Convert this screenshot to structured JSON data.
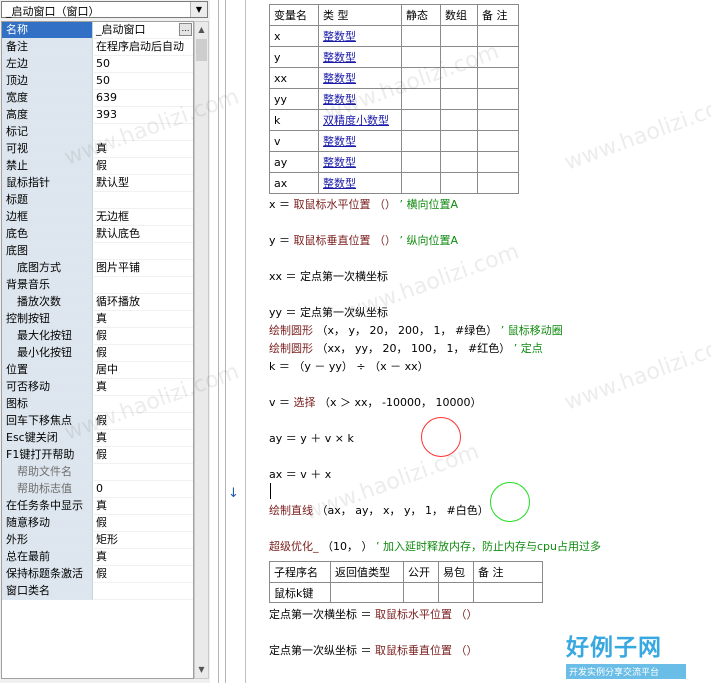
{
  "window_selector": {
    "value": "_启动窗口（窗口）"
  },
  "properties": [
    {
      "name": "名称",
      "value": "_启动窗口",
      "indent": false,
      "selected": true,
      "ellipsis": true
    },
    {
      "name": "备注",
      "value": "在程序启动后自动",
      "indent": false
    },
    {
      "name": "左边",
      "value": "50",
      "indent": false
    },
    {
      "name": "顶边",
      "value": "50",
      "indent": false
    },
    {
      "name": "宽度",
      "value": "639",
      "indent": false
    },
    {
      "name": "高度",
      "value": "393",
      "indent": false
    },
    {
      "name": "标记",
      "value": "",
      "indent": false
    },
    {
      "name": "可视",
      "value": "真",
      "indent": false
    },
    {
      "name": "禁止",
      "value": "假",
      "indent": false
    },
    {
      "name": "鼠标指针",
      "value": "默认型",
      "indent": false
    },
    {
      "name": "标题",
      "value": "",
      "indent": false
    },
    {
      "name": "边框",
      "value": "无边框",
      "indent": false
    },
    {
      "name": "底色",
      "value": "默认底色",
      "indent": false
    },
    {
      "name": "底图",
      "value": "",
      "indent": false
    },
    {
      "name": "底图方式",
      "value": "图片平铺",
      "indent": true
    },
    {
      "name": "背景音乐",
      "value": "",
      "indent": false
    },
    {
      "name": "播放次数",
      "value": "循环播放",
      "indent": true
    },
    {
      "name": "控制按钮",
      "value": "真",
      "indent": false
    },
    {
      "name": "最大化按钮",
      "value": "假",
      "indent": true
    },
    {
      "name": "最小化按钮",
      "value": "假",
      "indent": true
    },
    {
      "name": "位置",
      "value": "居中",
      "indent": false
    },
    {
      "name": "可否移动",
      "value": "真",
      "indent": false
    },
    {
      "name": "图标",
      "value": "",
      "indent": false
    },
    {
      "name": "回车下移焦点",
      "value": "假",
      "indent": false
    },
    {
      "name": "Esc键关闭",
      "value": "真",
      "indent": false
    },
    {
      "name": "F1键打开帮助",
      "value": "假",
      "indent": false
    },
    {
      "name": "帮助文件名",
      "value": "",
      "indent": true,
      "dim": true
    },
    {
      "name": "帮助标志值",
      "value": "0",
      "indent": true,
      "dim": true
    },
    {
      "name": "在任务条中显示",
      "value": "真",
      "indent": false
    },
    {
      "name": "随意移动",
      "value": "假",
      "indent": false
    },
    {
      "name": "外形",
      "value": "矩形",
      "indent": false
    },
    {
      "name": "总在最前",
      "value": "真",
      "indent": false
    },
    {
      "name": "保持标题条激活",
      "value": "假",
      "indent": false
    },
    {
      "name": "窗口类名",
      "value": "",
      "indent": false
    }
  ],
  "var_table": {
    "headers": [
      "变量名",
      "类 型",
      "静态",
      "数组",
      "备 注"
    ],
    "rows": [
      {
        "name": "x",
        "type": "整数型"
      },
      {
        "name": "y",
        "type": "整数型"
      },
      {
        "name": "xx",
        "type": "整数型"
      },
      {
        "name": "yy",
        "type": "整数型"
      },
      {
        "name": "k",
        "type": "双精度小数型"
      },
      {
        "name": "v",
        "type": "整数型"
      },
      {
        "name": "ay",
        "type": "整数型"
      },
      {
        "name": "ax",
        "type": "整数型"
      }
    ]
  },
  "code": {
    "l1": {
      "lhs": "x ＝ ",
      "fn": "取鼠标水平位置 （）",
      "cmt": " ’ 横向位置A"
    },
    "l2": {
      "lhs": "y ＝ ",
      "fn": "取鼠标垂直位置 （）",
      "cmt": " ’ 纵向位置A"
    },
    "l3": {
      "text": "xx ＝ 定点第一次横坐标"
    },
    "l4": {
      "text": "yy ＝ 定点第一次纵坐标"
    },
    "l5": {
      "fn": "绘制圆形",
      "args": " （x， y， 20， 200， 1， #绿色） ",
      "cmt": "’ 鼠标移动圈"
    },
    "l6": {
      "fn": "绘制圆形",
      "args": " （xx， yy， 20， 100， 1， #红色） ",
      "cmt": "’ 定点"
    },
    "l7": {
      "text": "k ＝ （y － yy） ÷ （x － xx）"
    },
    "l8": {
      "lhs": "v ＝ ",
      "fn": "选择",
      "args": " （x ＞ xx， -10000， 10000）"
    },
    "l9": {
      "text": "ay ＝ y ＋ v × k"
    },
    "l10": {
      "text": "ax ＝ v ＋ x"
    },
    "l11": {
      "fn": "绘制直线",
      "args": " （ax， ay， x， y， 1， #白色）"
    },
    "l12": {
      "fn": "超级优化_",
      "args": " （10， ） ",
      "cmt": "’ 加入延时释放内存，防止内存与cpu占用过多"
    },
    "l13": {
      "lhs": "定点第一次横坐标 ＝ ",
      "fn": "取鼠标水平位置 （）"
    },
    "l14": {
      "lhs": "定点第一次纵坐标 ＝ ",
      "fn": "取鼠标垂直位置 （）"
    }
  },
  "sub_table": {
    "headers": [
      "子程序名",
      "返回值类型",
      "公开",
      "易包",
      "备 注"
    ],
    "row": [
      "鼠标k键",
      "",
      "",
      "",
      ""
    ]
  },
  "circles": {
    "red": "#ff3030",
    "green": "#22dd22"
  },
  "watermark": "www.haolizi.com",
  "logo": {
    "big": "好例子网",
    "small": "开发实例分享交流平台"
  }
}
